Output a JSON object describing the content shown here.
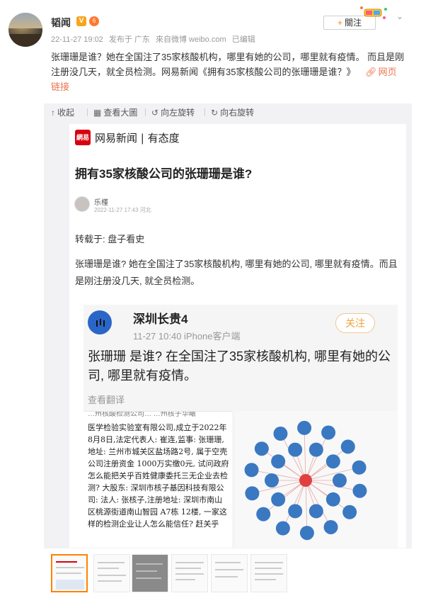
{
  "post": {
    "username": "韬闻",
    "v_badge": "V",
    "level_badge": "6",
    "timestamp": "22-11-27 19:02",
    "posted_from": "发布于 广东",
    "source": "來自微博 weibo.com",
    "edited": "已编辑",
    "follow_label": "關注",
    "text": "张珊珊是谁？她在全国注了35家核酸机构，哪里有她的公司，哪里就有疫情。 而且是刚注册没几天，就全员检测。网易新闻《拥有35家核酸公司的张珊珊是谁？》",
    "link_label": "网页链接"
  },
  "toolbar": {
    "collapse": "收起",
    "view_large": "查看大圖",
    "rotate_left": "向左旋转",
    "rotate_right": "向右旋转"
  },
  "article": {
    "logo_text": "網易",
    "brand": "网易新闻 | 有态度",
    "title": "拥有35家核酸公司的张珊珊是谁?",
    "author": "乐槿",
    "date": "2022-11-27 17:43 河北",
    "repost": "转载于:  盘子看史",
    "body": "张珊珊是谁? 她在全国注了35家核酸机构, 哪里有她的公司, 哪里就有疫情。而且是刚注册没几天, 就全员检测。"
  },
  "embed": {
    "name": "深圳长贵4",
    "time": "11-27 10:40  iPhone客户端",
    "follow": "关注",
    "text": "张珊珊 是谁? 在全国注了35家核酸机构, 哪里有她的公司, 哪里就有疫情。",
    "translate": "查看翻译",
    "left_top": "…州核酸检测公司…  …州核子华曦",
    "left_text": "医学检验实验室有限公司,成立于2022年8月8日,法定代表人: 崔连,监事: 张珊珊,地址: 兰州市城关区盐场路2号, 属于空壳公司注册资金 1000万实缴0元, 试问政府怎么能把关乎百姓健康委托三无企业去检测? 大股东: 深圳市核子基因科技有限公司: 法人: 张核子,注册地址: 深圳市南山区桃源街道南山智园 A7栋 12楼, 一家这样的检测企业让人怎么能信任? 赶关乎"
  },
  "colors": {
    "accent": "#ff8200",
    "link": "#eb7350",
    "netease_red": "#d7000f",
    "graph_node": "#3a78c2",
    "graph_center": "#e04040"
  },
  "icons": {
    "collapse": "arrow-up-icon",
    "view_large": "grid-icon",
    "rotate_left": "rotate-left-icon",
    "rotate_right": "rotate-right-icon",
    "link": "link-icon",
    "more": "chevron-down-icon"
  }
}
